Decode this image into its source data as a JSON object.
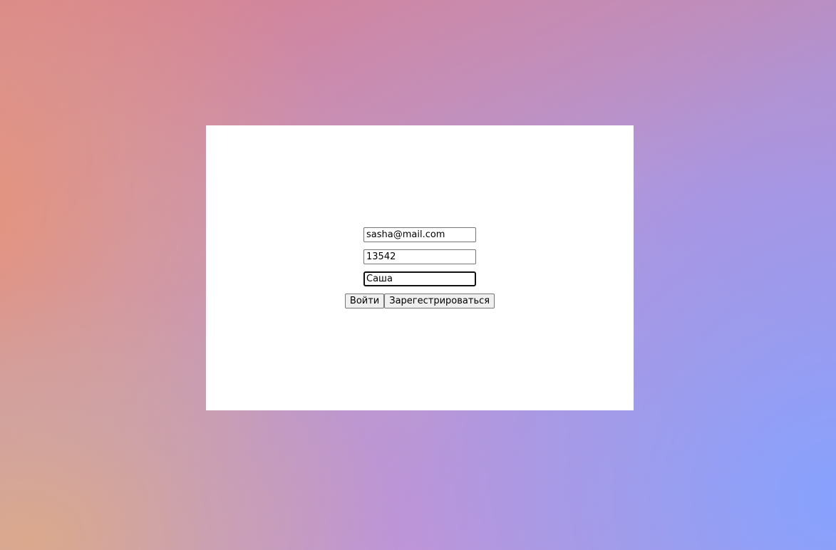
{
  "login_form": {
    "email_value": "sasha@mail.com",
    "password_value": "13542",
    "name_value": "Саша",
    "login_button_label": "Войти",
    "register_button_label": "Зарегестрироваться"
  },
  "colors": {
    "card_background": "#ffffff",
    "gradient_top_left": "#dd7f86",
    "gradient_top_right": "#a785d4",
    "gradient_bottom_left": "#dcae88",
    "gradient_bottom_right": "#86a2ff"
  }
}
